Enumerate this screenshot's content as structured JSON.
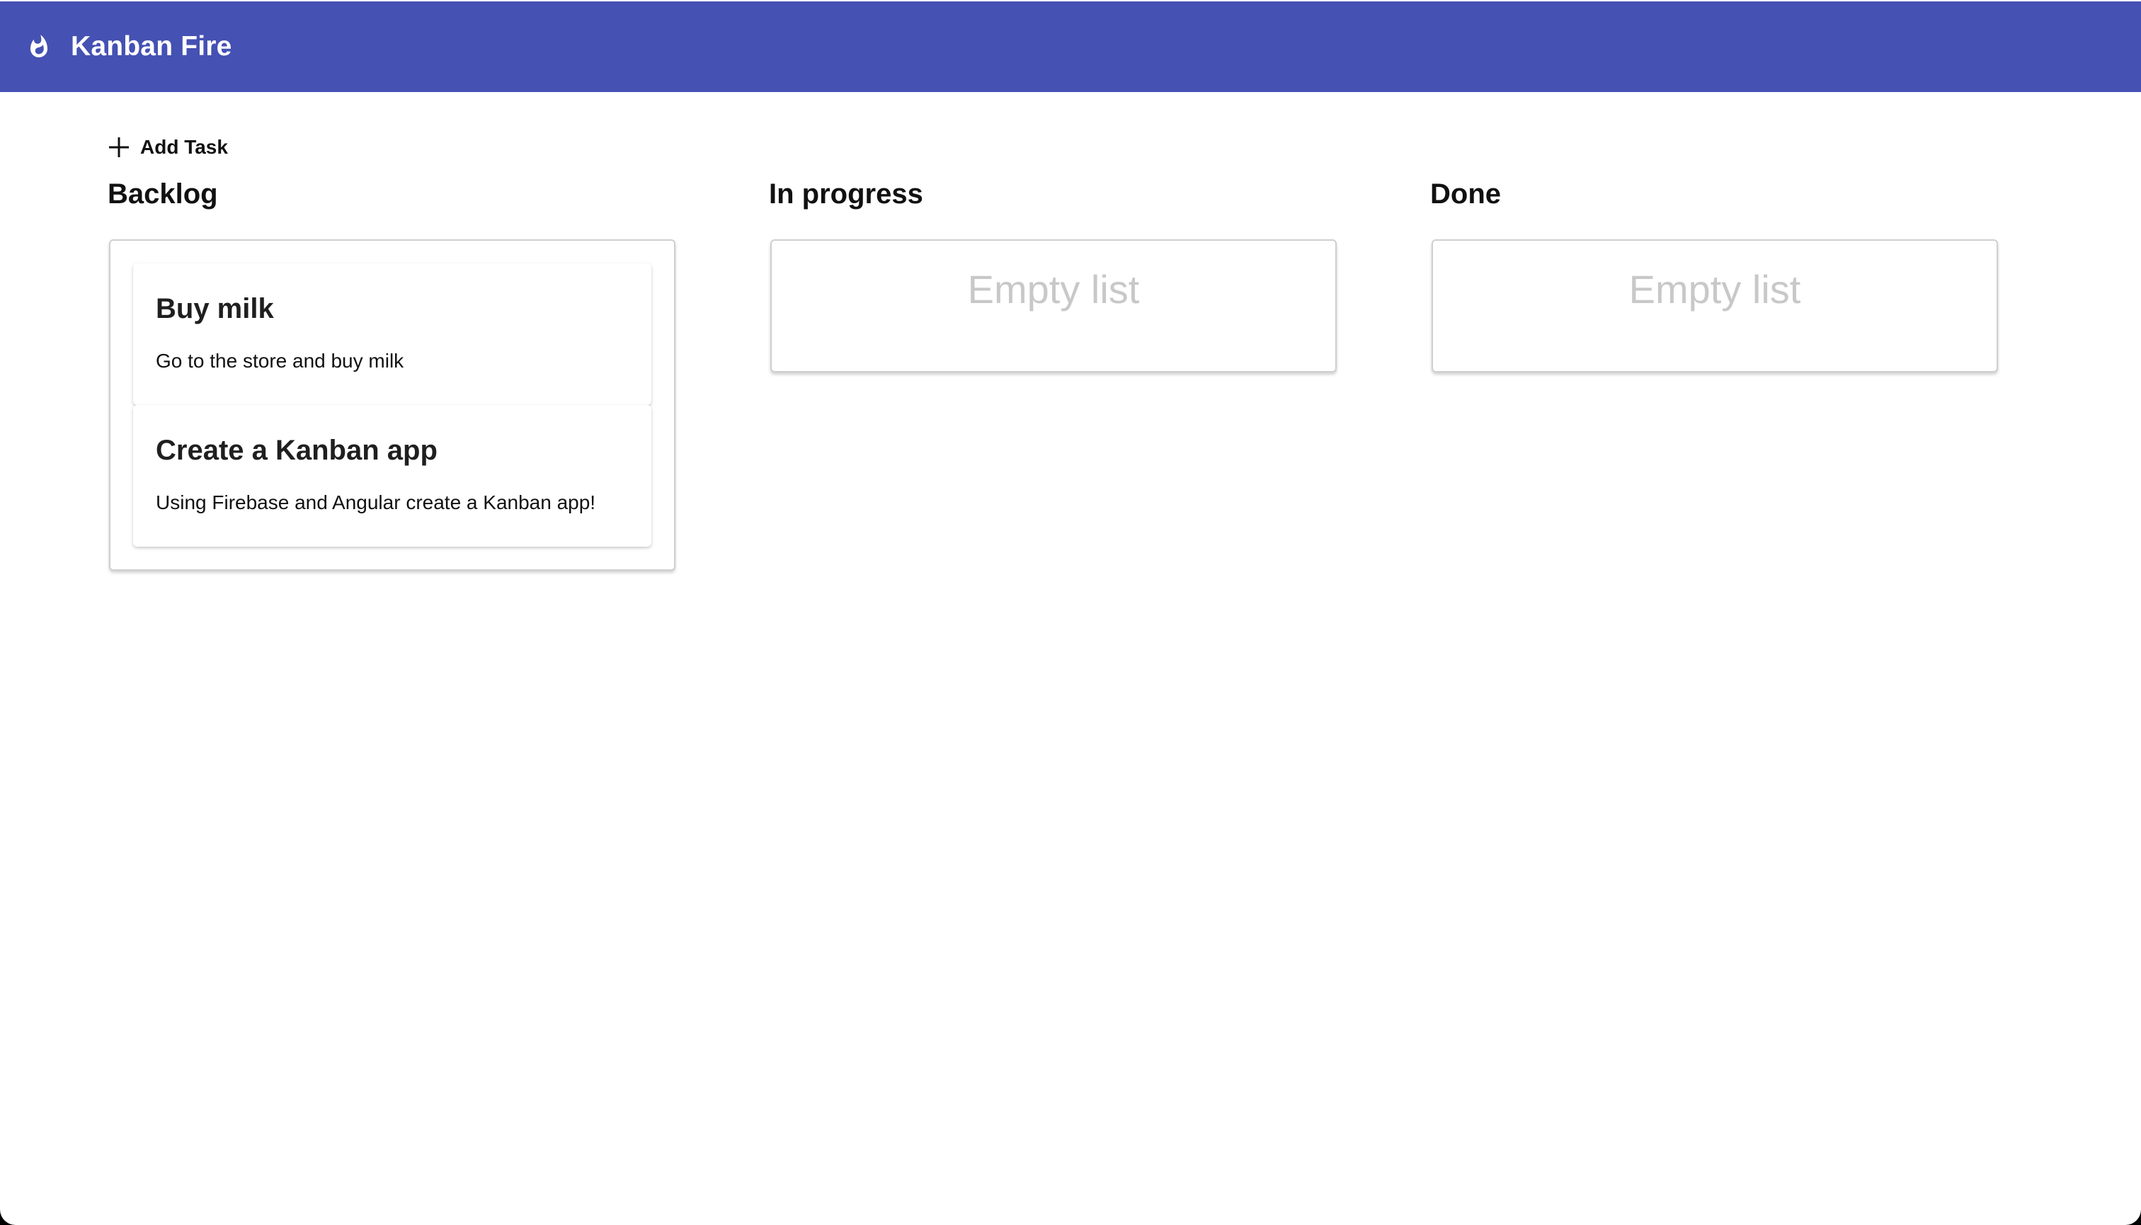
{
  "app": {
    "title": "Kanban Fire",
    "brand_color": "#4551b3",
    "logo_icon": "fire-icon"
  },
  "toolbar": {
    "add_task_label": "Add Task",
    "add_task_icon": "plus-icon"
  },
  "columns": [
    {
      "title": "Backlog",
      "tasks": [
        {
          "title": "Buy milk",
          "description": "Go to the store and buy milk"
        },
        {
          "title": "Create a Kanban app",
          "description": "Using Firebase and Angular create a Kanban app!"
        }
      ]
    },
    {
      "title": "In progress",
      "empty_text": "Empty list"
    },
    {
      "title": "Done",
      "empty_text": "Empty list"
    }
  ]
}
